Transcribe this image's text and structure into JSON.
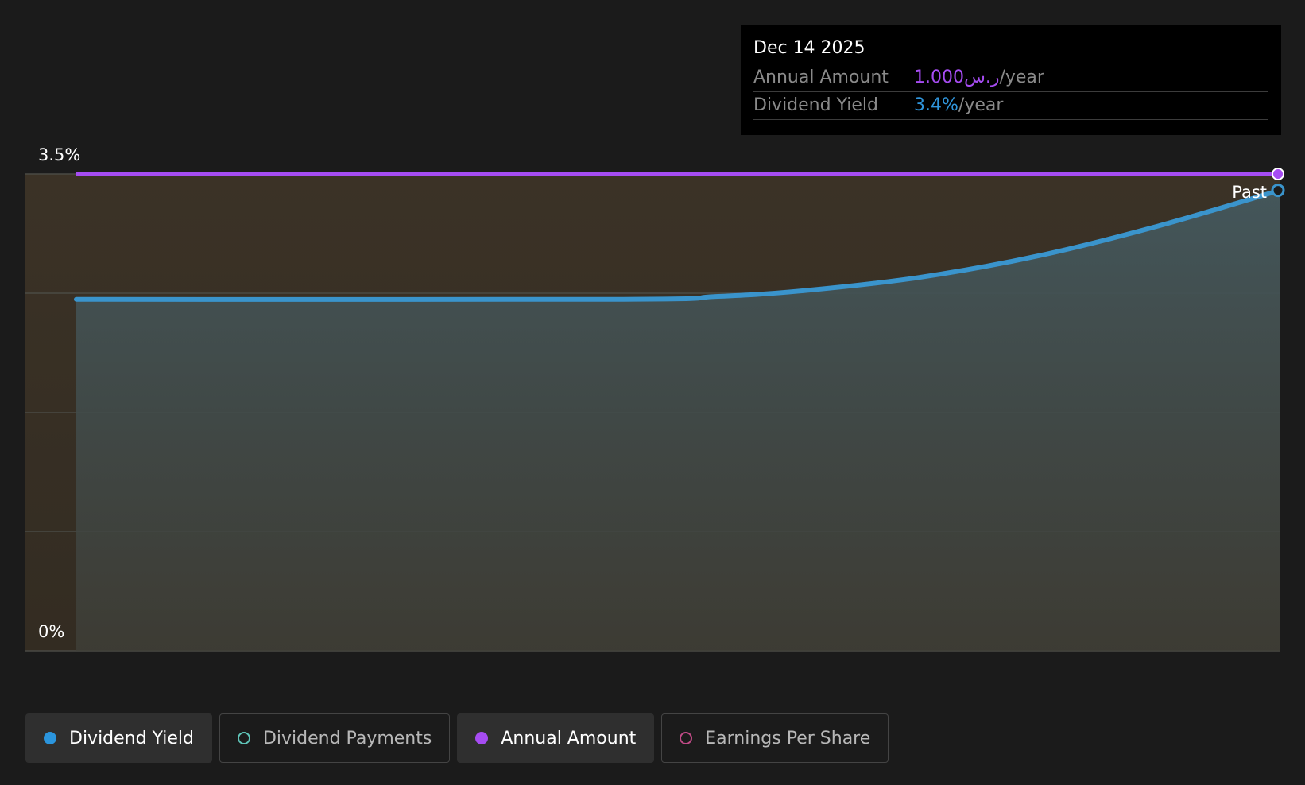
{
  "chart_data": {
    "type": "area",
    "y_axis": {
      "top_label": "3.5%",
      "bottom_label": "0%",
      "ylim": [
        0,
        3.5
      ],
      "gridlines": [
        0,
        0.875,
        1.75,
        2.625,
        3.5
      ]
    },
    "past_label": "Past",
    "series": [
      {
        "name": "Dividend Yield",
        "color": "#3a94cc",
        "points": [
          {
            "t": 0,
            "value": 2.58
          },
          {
            "t": 0.455,
            "value": 2.58
          },
          {
            "t": 0.53,
            "value": 2.6
          },
          {
            "t": 0.6,
            "value": 2.64
          },
          {
            "t": 0.7,
            "value": 2.74
          },
          {
            "t": 0.8,
            "value": 2.9
          },
          {
            "t": 0.9,
            "value": 3.12
          },
          {
            "t": 1.0,
            "value": 3.38
          }
        ]
      },
      {
        "name": "Annual Amount",
        "color": "#a64cf2",
        "points": [
          {
            "t": 0,
            "value": 3.5
          },
          {
            "t": 1.0,
            "value": 3.5
          }
        ]
      }
    ]
  },
  "tooltip": {
    "date": "Dec 14 2025",
    "rows": [
      {
        "label": "Annual Amount",
        "value": "1.000ر.س",
        "unit": "/year"
      },
      {
        "label": "Dividend Yield",
        "value": "3.4%",
        "unit": "/year"
      }
    ]
  },
  "legend": [
    {
      "label": "Dividend Yield",
      "color": "#2b95dd",
      "filled": true,
      "active": true
    },
    {
      "label": "Dividend Payments",
      "color": "#5fc4b8",
      "filled": false,
      "active": false
    },
    {
      "label": "Annual Amount",
      "color": "#a64cf2",
      "filled": true,
      "active": true
    },
    {
      "label": "Earnings Per Share",
      "color": "#c04a86",
      "filled": false,
      "active": false
    }
  ]
}
